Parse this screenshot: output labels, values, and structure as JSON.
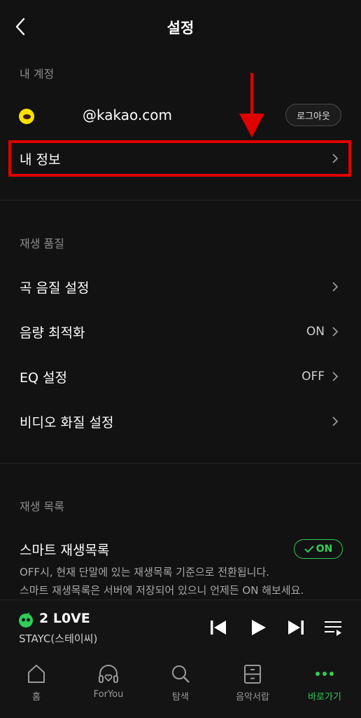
{
  "header": {
    "title": "설정"
  },
  "account": {
    "section_label": "내 계정",
    "email": "@kakao.com",
    "logout_label": "로그아웃",
    "my_info_label": "내 정보"
  },
  "playback_quality": {
    "section_label": "재생 품질",
    "items": [
      {
        "label": "곡 음질 설정",
        "value": ""
      },
      {
        "label": "음량 최적화",
        "value": "ON"
      },
      {
        "label": "EQ 설정",
        "value": "OFF"
      },
      {
        "label": "비디오 화질 설정",
        "value": ""
      }
    ]
  },
  "playlist": {
    "section_label": "재생 목록",
    "smart_label": "스마트 재생목록",
    "toggle_label": "ON",
    "toggle_on": true,
    "desc_line1": "OFF시, 현재 단말에 있는 재생목록 기준으로 전환됩니다.",
    "desc_line2": "스마트 재생목록은 서버에 저장되어 있으니 언제든 ON 해보세요."
  },
  "player": {
    "title": "2 L0VE",
    "artist": "STAYC(스테이씨)"
  },
  "nav": [
    {
      "label": "홈",
      "icon": "home-icon"
    },
    {
      "label": "ForYou",
      "icon": "headphones-heart-icon"
    },
    {
      "label": "탐색",
      "icon": "search-icon"
    },
    {
      "label": "음악서랍",
      "icon": "drawer-icon"
    },
    {
      "label": "바로가기",
      "icon": "more-dots-icon",
      "active": true
    }
  ],
  "colors": {
    "accent": "#2fcc5a",
    "highlight": "#e00000",
    "kakao": "#FAE100",
    "background": "#121212"
  }
}
